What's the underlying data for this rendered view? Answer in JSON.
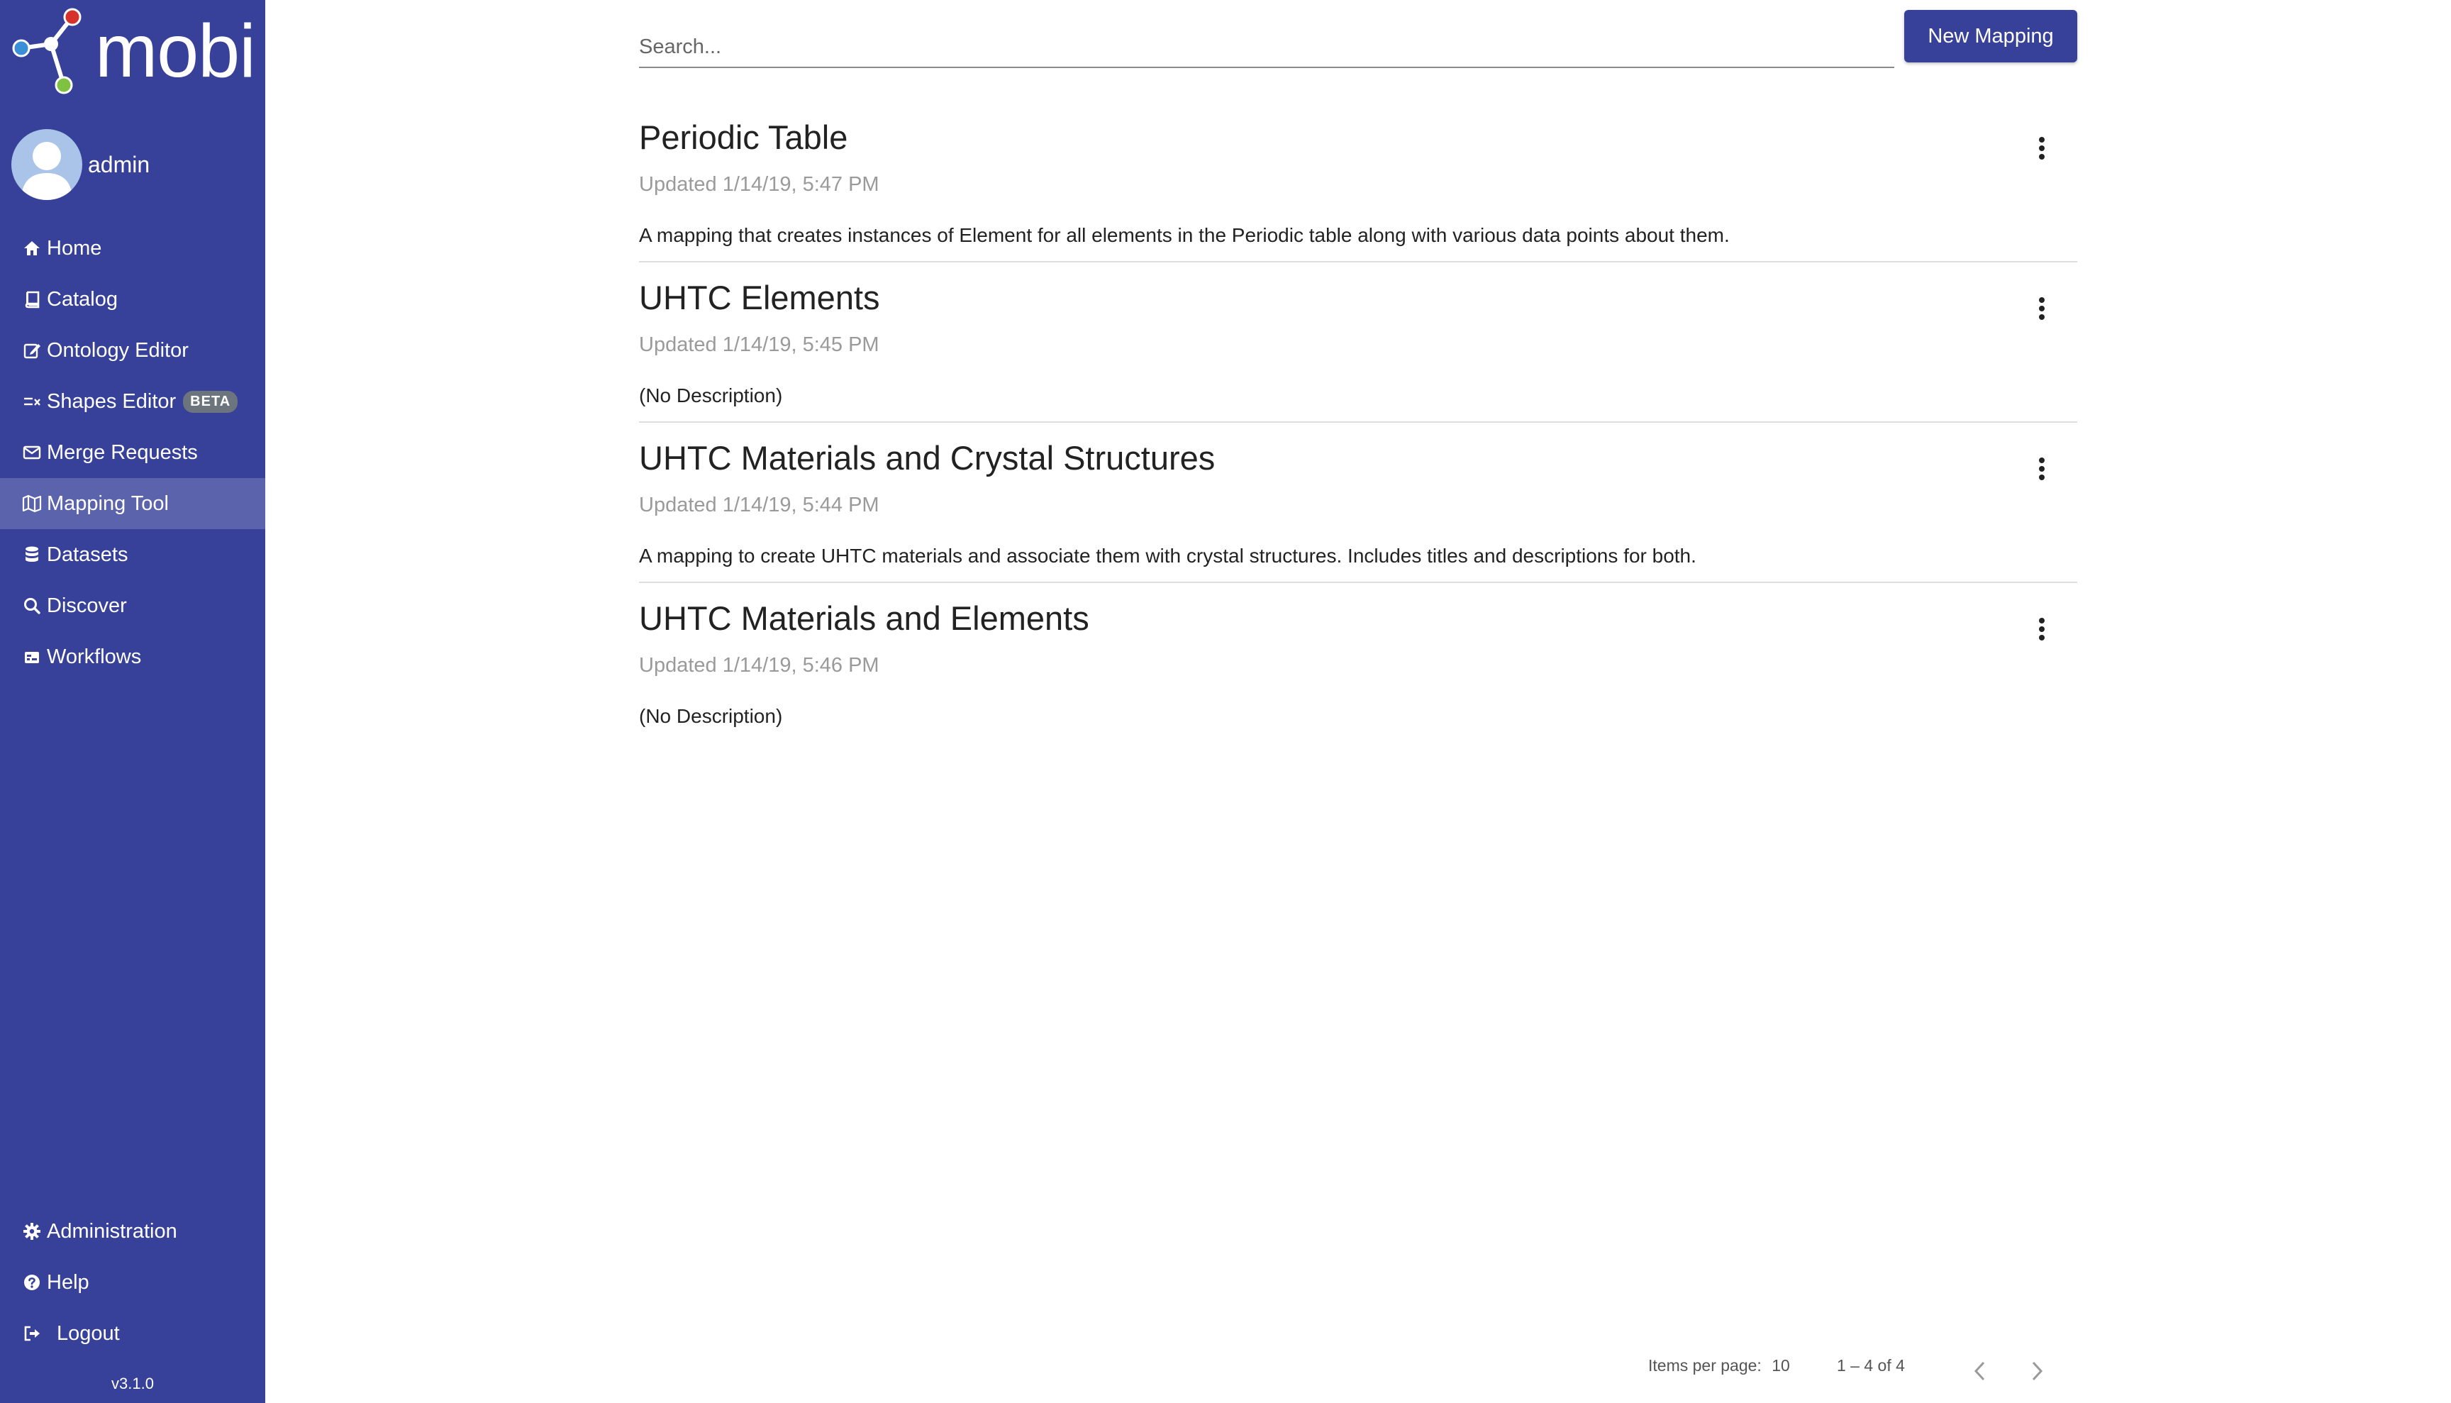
{
  "brand": {
    "name": "mobi",
    "logo_icon": "mobi-network-icon",
    "colors": {
      "sidebar": "#38419a",
      "sidebar_active": "#5a63ab",
      "primary_button": "#38419a",
      "node_red": "#d6312b",
      "node_green": "#7fc241",
      "node_blue": "#3b8fd6"
    }
  },
  "user": {
    "name": "admin",
    "avatar_icon": "user-avatar-icon"
  },
  "sidebar": {
    "items": [
      {
        "label": "Home",
        "icon": "home-icon"
      },
      {
        "label": "Catalog",
        "icon": "book-icon"
      },
      {
        "label": "Ontology Editor",
        "icon": "edit-icon"
      },
      {
        "label": "Shapes Editor",
        "icon": "shapes-icon",
        "badge": "BETA"
      },
      {
        "label": "Merge Requests",
        "icon": "envelope-icon"
      },
      {
        "label": "Mapping Tool",
        "icon": "map-icon",
        "active": true
      },
      {
        "label": "Datasets",
        "icon": "database-icon"
      },
      {
        "label": "Discover",
        "icon": "search-icon"
      },
      {
        "label": "Workflows",
        "icon": "workflow-icon"
      }
    ],
    "bottom_items": [
      {
        "label": "Administration",
        "icon": "gear-icon"
      },
      {
        "label": "Help",
        "icon": "question-circle-icon"
      },
      {
        "label": "Logout",
        "icon": "sign-out-icon"
      }
    ],
    "version": "v3.1.0"
  },
  "toolbar": {
    "search_placeholder": "Search...",
    "search_value": "",
    "new_button_label": "New Mapping"
  },
  "mappings": [
    {
      "title": "Periodic Table",
      "updated": "Updated 1/14/19, 5:47 PM",
      "description": "A mapping that creates instances of Element for all elements in the Periodic table along with various data points about them."
    },
    {
      "title": "UHTC Elements",
      "updated": "Updated 1/14/19, 5:45 PM",
      "description": "(No Description)"
    },
    {
      "title": "UHTC Materials and Crystal Structures",
      "updated": "Updated 1/14/19, 5:44 PM",
      "description": "A mapping to create UHTC materials and associate them with crystal structures. Includes titles and descriptions for both."
    },
    {
      "title": "UHTC Materials and Elements",
      "updated": "Updated 1/14/19, 5:46 PM",
      "description": "(No Description)"
    }
  ],
  "pagination": {
    "items_per_page_label": "Items per page:",
    "items_per_page_value": "10",
    "range_label": "1 – 4 of 4",
    "prev_icon": "chevron-left-icon",
    "next_icon": "chevron-right-icon"
  }
}
